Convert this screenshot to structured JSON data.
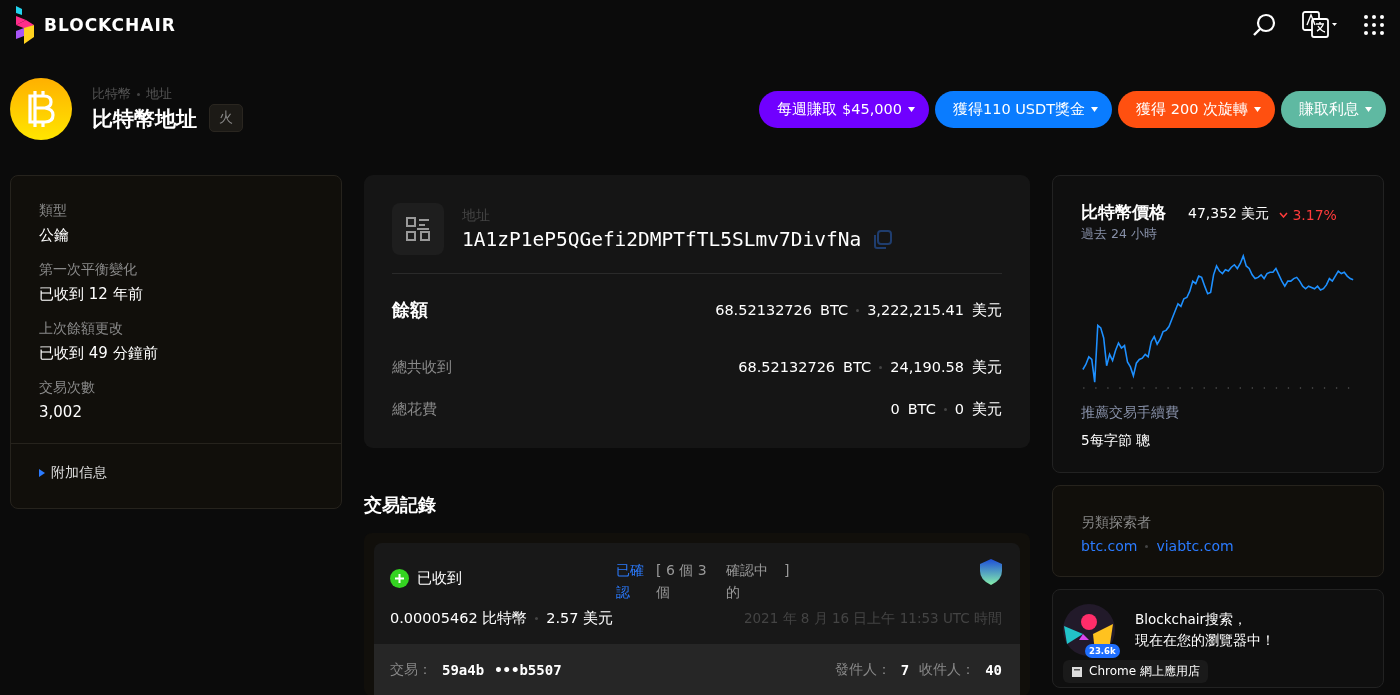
{
  "topbar": {
    "brand": "BLOCKCHAIR"
  },
  "header": {
    "breadcrumb": [
      "比特幣",
      "地址"
    ],
    "title": "比特幣地址",
    "tag": "火"
  },
  "promos": [
    {
      "label": "每週賺取 $45,000",
      "color": "#7000ff"
    },
    {
      "label": "獲得110 USDT獎金",
      "color": "#0a7cff"
    },
    {
      "label": "獲得 200 次旋轉",
      "color": "#ff5010"
    },
    {
      "label": "賺取利息",
      "color": "#5fb9a2"
    }
  ],
  "info": {
    "items": [
      {
        "label": "類型",
        "value": "公鑰"
      },
      {
        "label": "第一次平衡變化",
        "value": "已收到 12 年前"
      },
      {
        "label": "上次餘額更改",
        "value": "已收到 49 分鐘前"
      },
      {
        "label": "交易次數",
        "value": "3,002"
      }
    ],
    "more": {
      "label": "附加信息",
      "expanded": false
    }
  },
  "address": {
    "label": "地址",
    "value": "1A1zP1eP5QGefi2DMPTfTL5SLmv7DivfNa",
    "rows": [
      {
        "kind": "main",
        "label": "餘額",
        "btc": "68.52132726",
        "btc_unit": "BTC",
        "usd": "3,222,215.41",
        "usd_unit": "美元"
      },
      {
        "kind": "sub",
        "label": "總共收到",
        "btc": "68.52132726",
        "btc_unit": "BTC",
        "usd": "24,190.58",
        "usd_unit": "美元"
      },
      {
        "kind": "sub",
        "label": "總花費",
        "btc": "0",
        "btc_unit": "BTC",
        "usd": "0",
        "usd_unit": "美元"
      }
    ]
  },
  "transactions": {
    "title": "交易記錄",
    "items": [
      {
        "status": "已收到",
        "confirmed": "已確認",
        "confirm_parts": [
          "[ 6 個 3 個",
          "確認中的",
          "]"
        ],
        "amount": "0.00005462 比特幣",
        "usd": "2.57 美元",
        "time": "2021 年 8 月 16 日上午 11:53  UTC 時間",
        "hash_label": "交易：",
        "hash_start": "59a4b",
        "hash_end": "•••b5507",
        "senders_label": "發件人：",
        "senders": "7",
        "receivers_label": "收件人：",
        "receivers": "40"
      }
    ]
  },
  "price": {
    "title": "比特幣價格",
    "value": "47,352 美元",
    "change": "3.17%",
    "falling": true,
    "period": "過去 24 小時",
    "fee_label": "推薦交易手續費",
    "fee_value": "5每字節 聰"
  },
  "explorers": {
    "title": "另類探索者",
    "links": [
      "btc.com",
      "viabtc.com"
    ]
  },
  "extension": {
    "badge": "23.6k",
    "text_lines": [
      "Blockchair搜索，",
      "現在在您的瀏覽器中！"
    ],
    "button": "Chrome 網上應用店"
  }
}
